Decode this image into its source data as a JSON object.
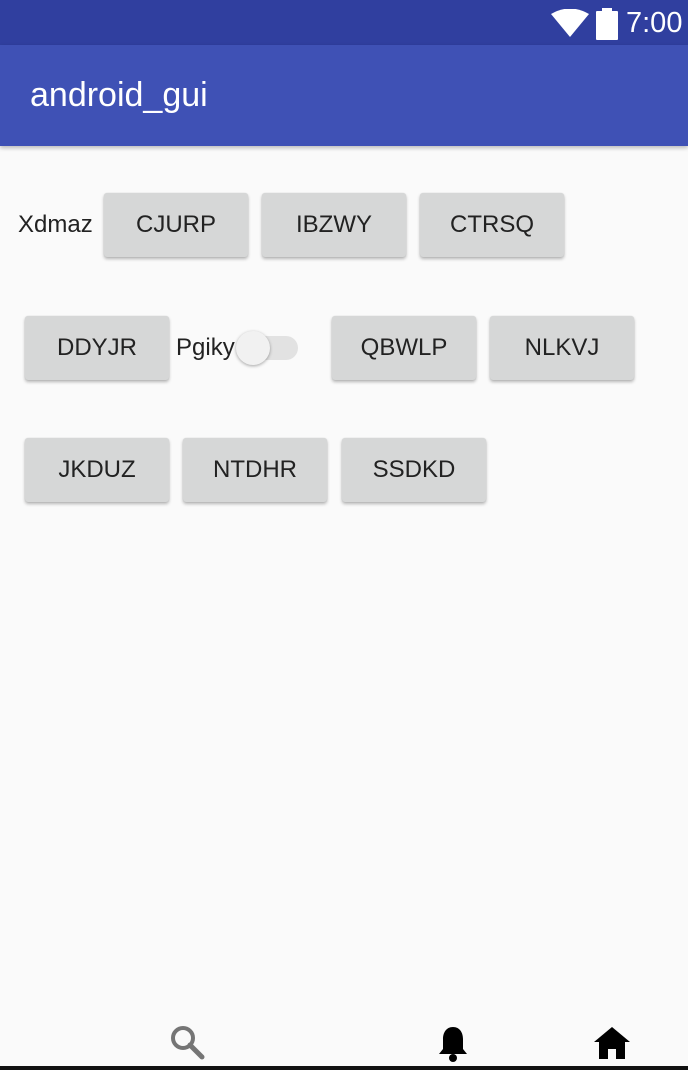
{
  "status_bar": {
    "time": "7:00",
    "icons": [
      "wifi-icon",
      "battery-icon"
    ]
  },
  "app_bar": {
    "title": "android_gui"
  },
  "content": {
    "row1": {
      "label": "Xdmaz",
      "buttons": [
        "CJURP",
        "IBZWY",
        "CTRSQ"
      ]
    },
    "row2": {
      "buttons_before": [
        "DDYJR"
      ],
      "switch_label": "Pgiky",
      "switch_on": false,
      "buttons_after": [
        "QBWLP",
        "NLKVJ"
      ]
    },
    "row3": {
      "buttons": [
        "JKDUZ",
        "NTDHR",
        "SSDKD"
      ]
    }
  },
  "bottom_nav": {
    "icons": [
      "search-icon",
      "bell-icon",
      "home-icon"
    ]
  },
  "colors": {
    "status_bar": "#303f9f",
    "app_bar": "#3f51b5",
    "background": "#fafafa",
    "button": "#d6d7d7"
  }
}
